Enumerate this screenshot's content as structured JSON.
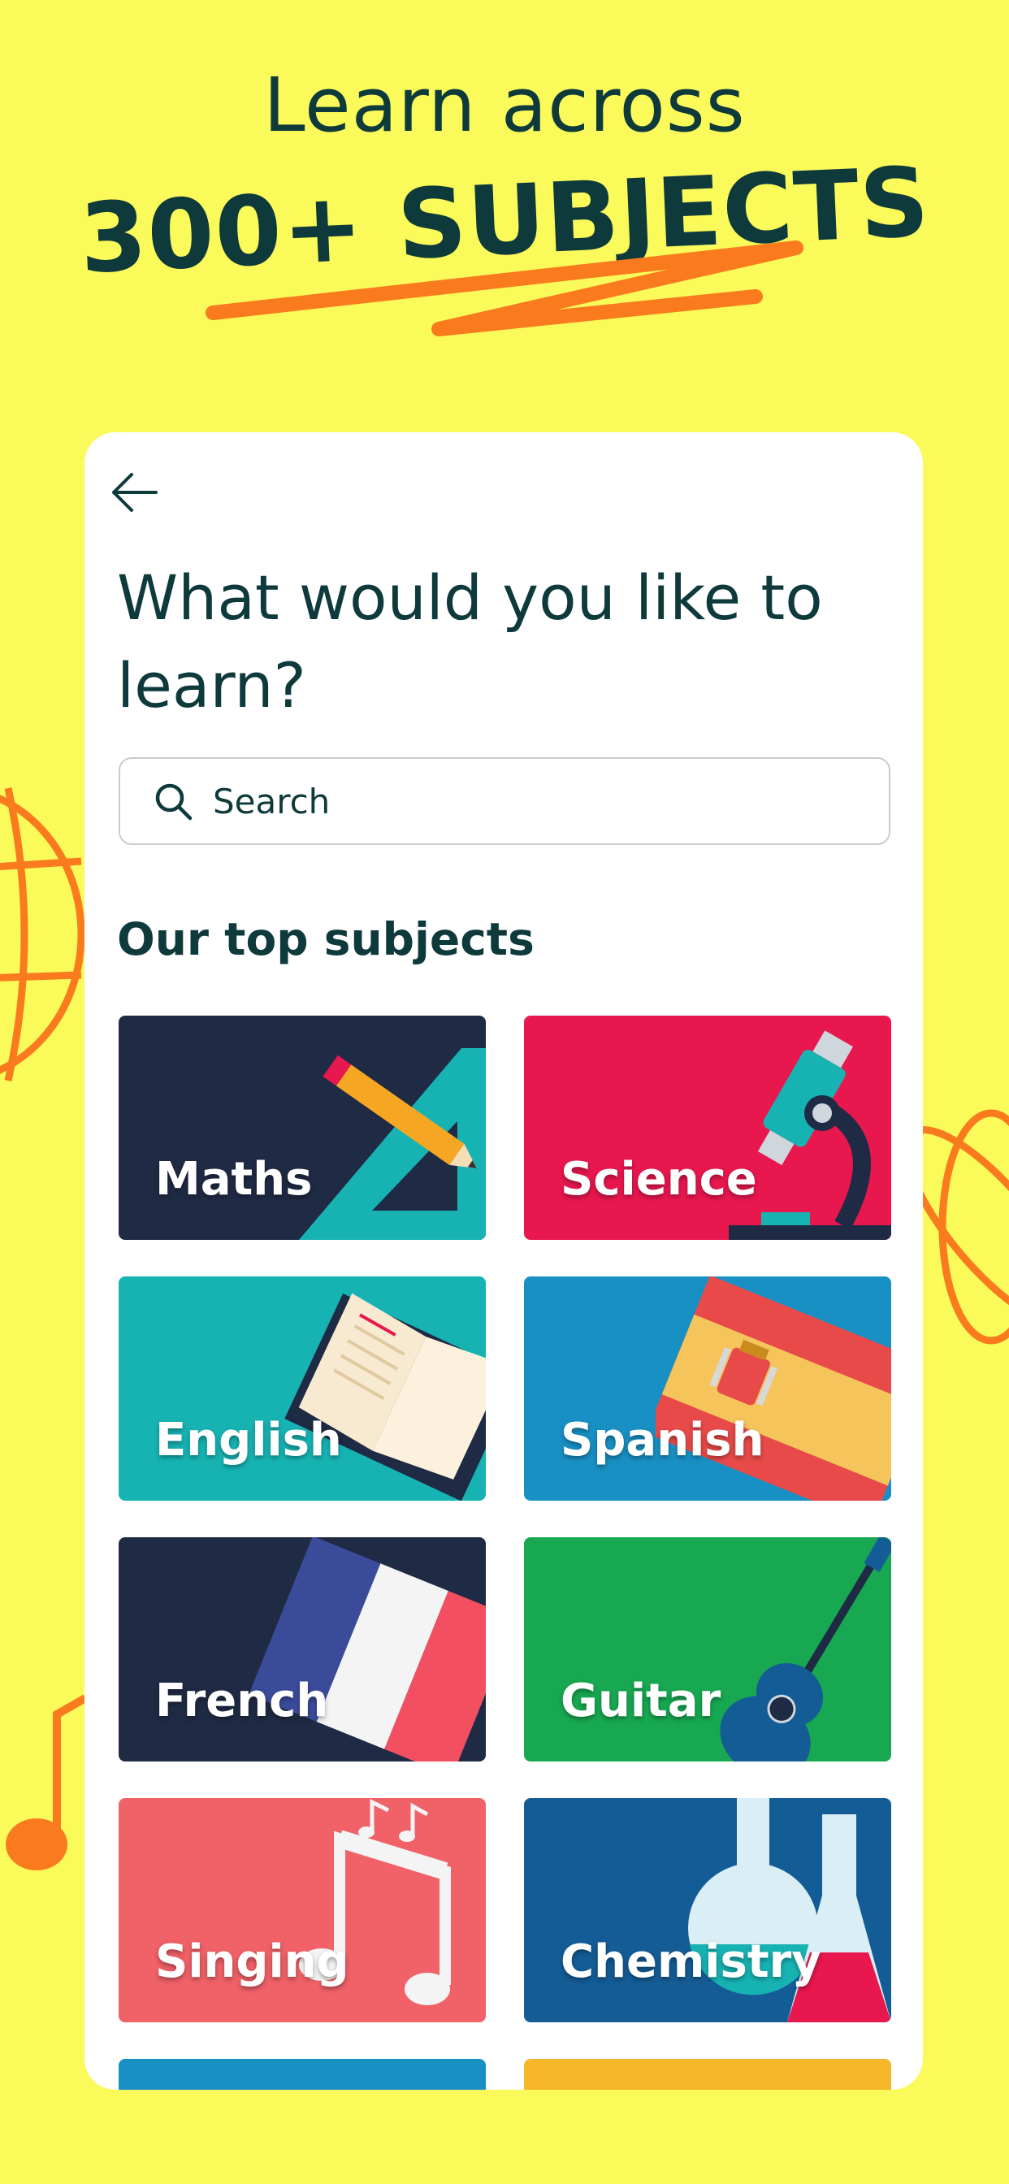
{
  "promo": {
    "line1": "Learn across",
    "line2": "300+ SUBJECTS"
  },
  "screen": {
    "title": "What would you like to learn?",
    "search": {
      "placeholder": "Search"
    },
    "section_title": "Our top subjects",
    "subjects": [
      {
        "label": "Maths",
        "color": "#1f2a44",
        "icon": "pencil-ruler-icon"
      },
      {
        "label": "Science",
        "color": "#e8174e",
        "icon": "microscope-icon"
      },
      {
        "label": "English",
        "color": "#17b3b3",
        "icon": "open-book-icon"
      },
      {
        "label": "Spanish",
        "color": "#1890c4",
        "icon": "spain-flag-icon"
      },
      {
        "label": "French",
        "color": "#1f2a44",
        "icon": "france-flag-icon"
      },
      {
        "label": "Guitar",
        "color": "#17a851",
        "icon": "guitar-icon"
      },
      {
        "label": "Singing",
        "color": "#f06168",
        "icon": "music-notes-icon"
      },
      {
        "label": "Chemistry",
        "color": "#145c96",
        "icon": "flask-icon"
      }
    ]
  },
  "colors": {
    "background": "#fafa5a",
    "text_dark": "#0f3a3c",
    "accent_orange": "#fa7a1e"
  }
}
